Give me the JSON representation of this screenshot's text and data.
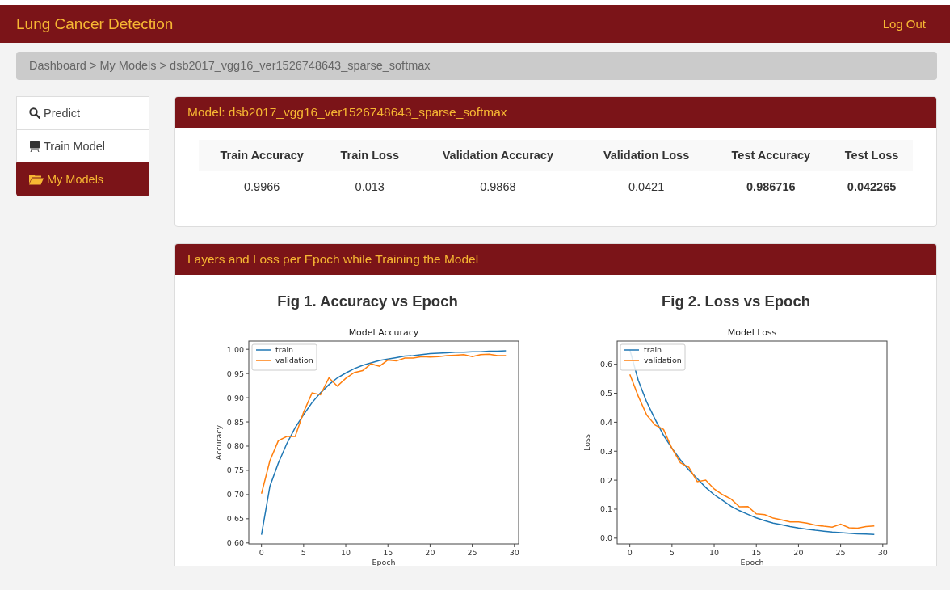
{
  "header": {
    "title": "Lung Cancer Detection",
    "logout": "Log Out"
  },
  "breadcrumb": "Dashboard > My Models > dsb2017_vgg16_ver1526748643_sparse_softmax",
  "sidebar": {
    "items": [
      {
        "label": "Predict",
        "selected": false
      },
      {
        "label": "Train Model",
        "selected": false
      },
      {
        "label": "My Models",
        "selected": true
      }
    ]
  },
  "model_panel": {
    "title": "Model: dsb2017_vgg16_ver1526748643_sparse_softmax",
    "table": {
      "columns": [
        "Train Accuracy",
        "Train Loss",
        "Validation Accuracy",
        "Validation Loss",
        "Test Accuracy",
        "Test Loss"
      ],
      "rows": [
        [
          {
            "text": "0.9966",
            "bold": false
          },
          {
            "text": "0.013",
            "bold": false
          },
          {
            "text": "0.9868",
            "bold": false
          },
          {
            "text": "0.0421",
            "bold": false
          },
          {
            "text": "0.986716",
            "bold": true
          },
          {
            "text": "0.042265",
            "bold": true
          }
        ]
      ]
    }
  },
  "charts_panel": {
    "title": "Layers and Loss per Epoch while Training the Model",
    "figures": [
      {
        "caption": "Fig 1. Accuracy vs Epoch",
        "chart_data": {
          "type": "line",
          "title": "Model Accuracy",
          "xlabel": "Epoch",
          "ylabel": "Accuracy",
          "x": [
            0,
            1,
            2,
            3,
            4,
            5,
            6,
            7,
            8,
            9,
            10,
            11,
            12,
            13,
            14,
            15,
            16,
            17,
            18,
            19,
            20,
            21,
            22,
            23,
            24,
            25,
            26,
            27,
            28,
            29
          ],
          "series": [
            {
              "name": "train",
              "color": "#1f77b4",
              "values": [
                0.617,
                0.717,
                0.765,
                0.805,
                0.838,
                0.865,
                0.89,
                0.91,
                0.927,
                0.941,
                0.951,
                0.96,
                0.967,
                0.972,
                0.977,
                0.98,
                0.983,
                0.986,
                0.987,
                0.989,
                0.991,
                0.992,
                0.993,
                0.994,
                0.994,
                0.995,
                0.995,
                0.996,
                0.996,
                0.997
              ]
            },
            {
              "name": "validation",
              "color": "#ff7f0e",
              "values": [
                0.702,
                0.77,
                0.811,
                0.82,
                0.82,
                0.87,
                0.91,
                0.906,
                0.941,
                0.924,
                0.94,
                0.952,
                0.956,
                0.97,
                0.965,
                0.978,
                0.976,
                0.982,
                0.982,
                0.985,
                0.984,
                0.985,
                0.987,
                0.988,
                0.989,
                0.985,
                0.989,
                0.99,
                0.987,
                0.987
              ]
            }
          ],
          "legend": "upper left",
          "xlim": [
            -1.5,
            30.5
          ],
          "ylim": [
            0.598,
            1.017
          ],
          "xticks": [
            0,
            5,
            10,
            15,
            20,
            25,
            30
          ],
          "yticks": [
            {
              "value": 0.6,
              "label": "0.60"
            },
            {
              "value": 0.65,
              "label": "0.65"
            },
            {
              "value": 0.7,
              "label": "0.70"
            },
            {
              "value": 0.75,
              "label": "0.75"
            },
            {
              "value": 0.8,
              "label": "0.80"
            },
            {
              "value": 0.85,
              "label": "0.85"
            },
            {
              "value": 0.9,
              "label": "0.90"
            },
            {
              "value": 0.95,
              "label": "0.95"
            },
            {
              "value": 1.0,
              "label": "1.00"
            }
          ]
        }
      },
      {
        "caption": "Fig 2. Loss vs Epoch",
        "chart_data": {
          "type": "line",
          "title": "Model Loss",
          "xlabel": "Epoch",
          "ylabel": "Loss",
          "x": [
            0,
            1,
            2,
            3,
            4,
            5,
            6,
            7,
            8,
            9,
            10,
            11,
            12,
            13,
            14,
            15,
            16,
            17,
            18,
            19,
            20,
            21,
            22,
            23,
            24,
            25,
            26,
            27,
            28,
            29
          ],
          "series": [
            {
              "name": "train",
              "color": "#1f77b4",
              "values": [
                0.65,
                0.545,
                0.47,
                0.41,
                0.355,
                0.31,
                0.27,
                0.235,
                0.205,
                0.175,
                0.15,
                0.13,
                0.11,
                0.095,
                0.082,
                0.07,
                0.06,
                0.052,
                0.046,
                0.04,
                0.035,
                0.031,
                0.027,
                0.024,
                0.021,
                0.019,
                0.017,
                0.015,
                0.014,
                0.013
              ]
            },
            {
              "name": "validation",
              "color": "#ff7f0e",
              "values": [
                0.565,
                0.49,
                0.425,
                0.39,
                0.375,
                0.31,
                0.26,
                0.245,
                0.195,
                0.2,
                0.17,
                0.15,
                0.135,
                0.108,
                0.109,
                0.084,
                0.081,
                0.069,
                0.063,
                0.056,
                0.056,
                0.052,
                0.045,
                0.041,
                0.038,
                0.048,
                0.036,
                0.034,
                0.04,
                0.042
              ]
            }
          ],
          "legend": "upper left",
          "xlim": [
            -1.5,
            30.5
          ],
          "ylim": [
            -0.02,
            0.68
          ],
          "xticks": [
            0,
            5,
            10,
            15,
            20,
            25,
            30
          ],
          "yticks": [
            {
              "value": 0,
              "label": "0.0"
            },
            {
              "value": 0.1,
              "label": "0.1"
            },
            {
              "value": 0.2,
              "label": "0.2"
            },
            {
              "value": 0.3,
              "label": "0.3"
            },
            {
              "value": 0.4,
              "label": "0.4"
            },
            {
              "value": 0.5,
              "label": "0.5"
            },
            {
              "value": 0.6,
              "label": "0.6"
            }
          ]
        }
      }
    ]
  }
}
